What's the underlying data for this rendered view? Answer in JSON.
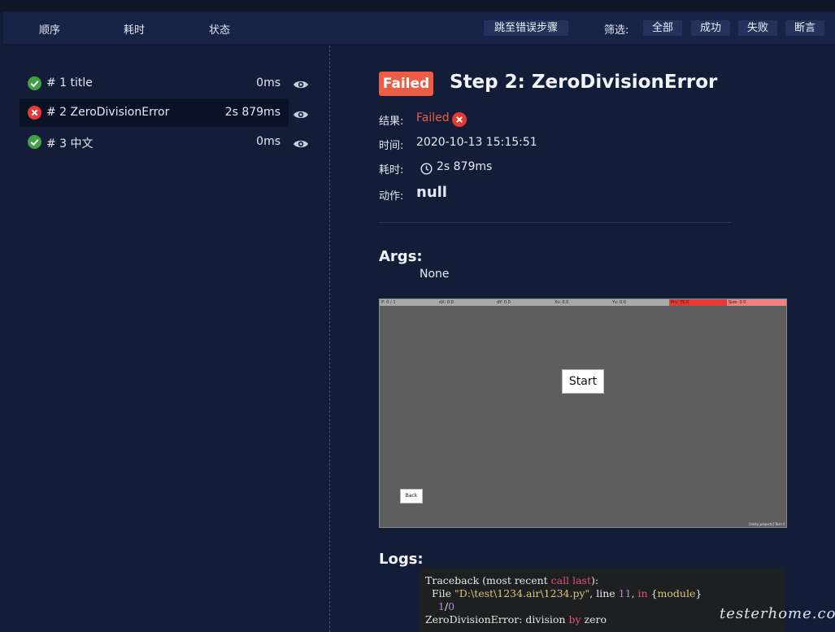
{
  "toolbar": {
    "sort_tabs": [
      "顺序",
      "耗时",
      "状态"
    ],
    "jump_to_error": "跳至错误步骤",
    "filter_label": "筛选:",
    "filters": [
      "全部",
      "成功",
      "失败",
      "断言"
    ]
  },
  "steps": [
    {
      "index": "# 1",
      "name": "title",
      "duration": "0ms",
      "status": "success"
    },
    {
      "index": "# 2",
      "name": "ZeroDivisionError",
      "duration": "2s 879ms",
      "status": "failed"
    },
    {
      "index": "# 3",
      "name": "中文",
      "duration": "0ms",
      "status": "success"
    }
  ],
  "detail": {
    "badge": "Failed",
    "title": "Step 2: ZeroDivisionError",
    "result_label": "结果:",
    "result_value": "Failed",
    "time_label": "时间:",
    "time_value": "2020-10-13 15:15:51",
    "duration_label": "耗时:",
    "duration_value": "2s 879ms",
    "action_label": "动作:",
    "action_value": "null",
    "args_heading": "Args:",
    "args_value": "None",
    "logs_heading": "Logs:"
  },
  "screenshot": {
    "bar_cells": [
      "P: 0 / 1",
      "dX: 0.0",
      "dY: 0.0",
      "Xv: 0.0",
      "Yv: 0.0",
      "Prs: 75.0",
      "Size: 0.0"
    ],
    "start_label": "Start",
    "back_label": "Back",
    "corner_text": "[Unity projects] Test 4"
  },
  "logs": {
    "l1_a": "Traceback (most recent ",
    "l1_b": "call last",
    "l1_c": "):",
    "l2_a": "  File ",
    "l2_b": "\"D:\\test\\1234.air\\1234.py\"",
    "l2_c": ", line ",
    "l2_d": "11",
    "l2_e": ", ",
    "l2_f": "in",
    "l2_g": " {",
    "l2_h": "module",
    "l2_i": "}",
    "l3_a": "    ",
    "l3_b": "1",
    "l3_c": "/",
    "l3_d": "0",
    "l4_a": "ZeroDivisionError: division ",
    "l4_b": "by",
    "l4_c": " zero"
  },
  "watermark": "testerhome.com",
  "colors": {
    "success": "#43a047",
    "failed": "#e53935",
    "accent_red": "#ef5c45"
  }
}
